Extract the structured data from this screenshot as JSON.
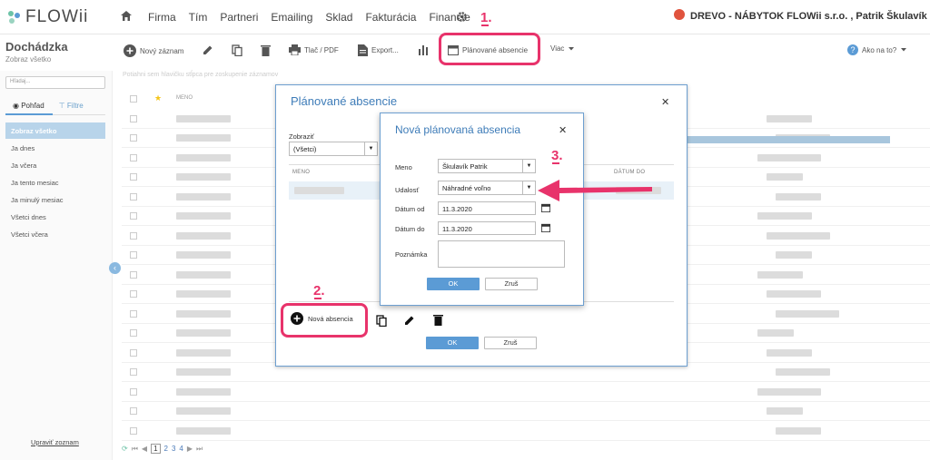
{
  "app": {
    "logo": "FLOWii"
  },
  "nav": [
    "Firma",
    "Tím",
    "Partneri",
    "Emailing",
    "Sklad",
    "Fakturácia",
    "Financie"
  ],
  "company": "DREVO - NÁBYTOK FLOWii s.r.o. , Patrik Škulavík",
  "page": {
    "title": "Dochádzka",
    "subtitle": "Zobraz všetko"
  },
  "toolbar": {
    "new_record": "Nový záznam",
    "print": "Tlač / PDF",
    "export": "Export...",
    "planned": "Plánované absencie",
    "more": "Viac",
    "help": "Ako na to?"
  },
  "grid_hint": "Potiahni sem hlavičku stĺpca pre zoskupenie záznamov",
  "grid_header": {
    "name": "MENO"
  },
  "sidebar": {
    "search_placeholder": "Hľadaj...",
    "tab_view": "Pohľad",
    "tab_filters": "Filtre",
    "items": [
      "Zobraz všetko",
      "Ja dnes",
      "Ja včera",
      "Ja tento mesiac",
      "Ja minulý mesiac",
      "Všetci dnes",
      "Všetci včera"
    ],
    "manage": "Upraviť zoznam"
  },
  "pager": {
    "pages": [
      "1",
      "2",
      "3",
      "4"
    ]
  },
  "dialog_planned": {
    "title": "Plánované absencie",
    "show_label": "Zobraziť",
    "show_value": "(Všetci)",
    "col_name": "MENO",
    "col_date_to": "DÁTUM DO",
    "new_button": "Nová absencia",
    "ok": "OK",
    "cancel": "Zruš"
  },
  "dialog_new": {
    "title": "Nová plánovaná absencia",
    "name_label": "Meno",
    "name_value": "Škulavík Patrik",
    "event_label": "Udalosť",
    "event_value": "Náhradné voľno",
    "date_from_label": "Dátum od",
    "date_from_value": "11.3.2020",
    "date_to_label": "Dátum do",
    "date_to_value": "11.3.2020",
    "note_label": "Poznámka",
    "ok": "OK",
    "cancel": "Zruš"
  },
  "annotations": {
    "step1": "1.",
    "step2": "2.",
    "step3": "3."
  },
  "colors": {
    "accent": "#5b9bd5",
    "highlight": "#e8336b",
    "title_blue": "#3e7cb8"
  }
}
